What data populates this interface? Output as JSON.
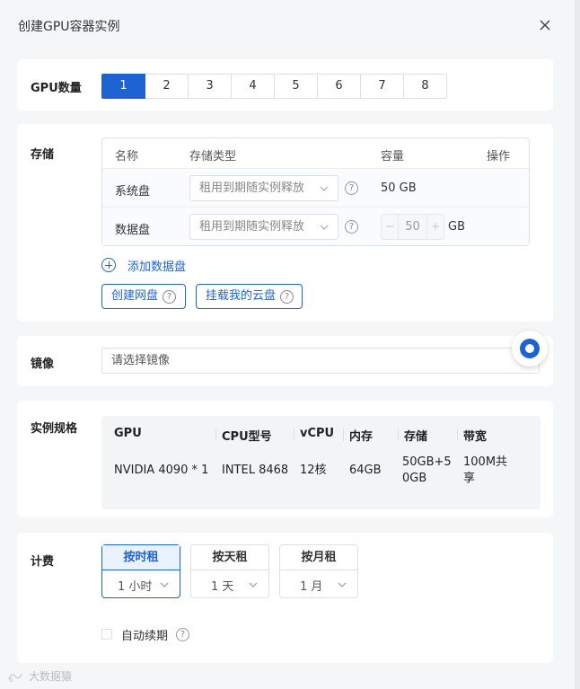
{
  "dialog": {
    "title": "创建GPU容器实例"
  },
  "gpu_count": {
    "label": "GPU数量",
    "options": [
      "1",
      "2",
      "3",
      "4",
      "5",
      "6",
      "7",
      "8"
    ],
    "selected": "1"
  },
  "storage": {
    "label": "存储",
    "headers": {
      "name": "名称",
      "type": "存储类型",
      "capacity": "容量",
      "action": "操作"
    },
    "system_disk": {
      "name": "系统盘",
      "type": "租用到期随实例释放",
      "capacity": "50 GB"
    },
    "data_disk": {
      "name": "数据盘",
      "type": "租用到期随实例释放",
      "value": "50",
      "unit": "GB",
      "minus": "−",
      "plus": "+"
    },
    "add_label": "添加数据盘",
    "create_net_disk": "创建网盘",
    "mount_cloud_disk": "挂载我的云盘",
    "help_glyph": "?"
  },
  "image": {
    "label": "镜像",
    "placeholder": "请选择镜像"
  },
  "spec": {
    "label": "实例规格",
    "headers": {
      "gpu": "GPU",
      "cpu": "CPU型号",
      "vcpu": "vCPU",
      "mem": "内存",
      "storage": "存储",
      "bw": "带宽"
    },
    "row": {
      "gpu": "NVIDIA 4090 * 1",
      "cpu": "INTEL 8468",
      "vcpu": "12核",
      "mem": "64GB",
      "storage_l1": "50GB+5",
      "storage_l2": "0GB",
      "bw_l1": "100M共",
      "bw_l2": "享"
    }
  },
  "billing": {
    "label": "计费",
    "options": [
      {
        "title": "按时租",
        "value": "1 小时",
        "active": true
      },
      {
        "title": "按天租",
        "value": "1 天",
        "active": false
      },
      {
        "title": "按月租",
        "value": "1 月",
        "active": false
      }
    ],
    "auto_renew": "自动续期"
  },
  "watermark": "大数据猿",
  "colors": {
    "primary": "#1e63d4",
    "border": "#dcdfe6",
    "bg": "#f5f6f8"
  }
}
